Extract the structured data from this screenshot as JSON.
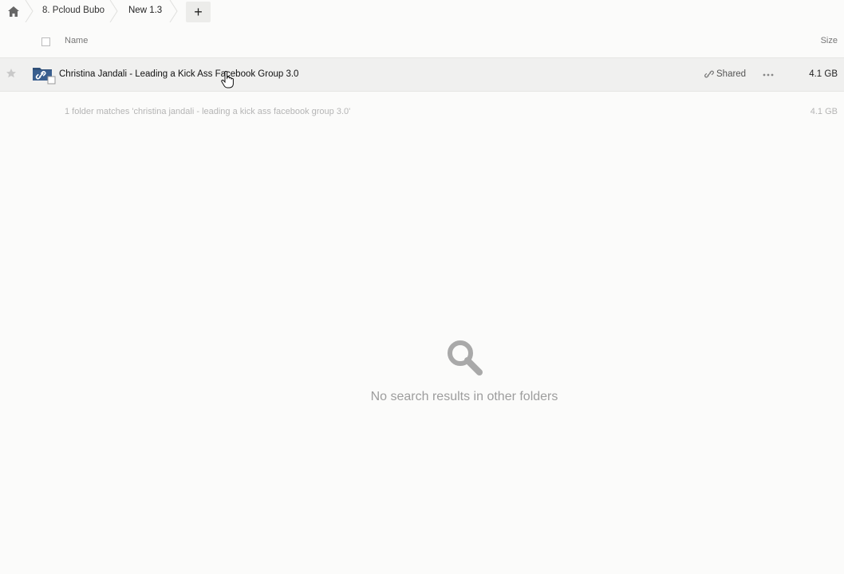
{
  "breadcrumb": {
    "home_icon": "home-icon",
    "items": [
      {
        "label": "8. Pcloud Bubo"
      },
      {
        "label": "New 1.3"
      }
    ],
    "add_icon": "plus-icon",
    "add_label": "+"
  },
  "header": {
    "name_label": "Name",
    "size_label": "Size"
  },
  "rows": [
    {
      "name": "Christina Jandali - Leading a Kick Ass Facebook Group 3.0",
      "icon": "shared-folder-icon",
      "shared_label": "Shared",
      "shared_icon": "link-icon",
      "more_icon": "more-options-icon",
      "size": "4.1 GB"
    }
  ],
  "summary": {
    "text": "1 folder matches 'christina jandali - leading a kick ass facebook group 3.0'",
    "size": "4.1 GB"
  },
  "empty_state": {
    "icon": "search-icon",
    "message": "No search results in other folders"
  },
  "colors": {
    "background": "#fbfbfa",
    "row_hover": "#f0f0ef",
    "folder_blue": "#2f4f78",
    "muted_text": "#9d9d9d"
  }
}
